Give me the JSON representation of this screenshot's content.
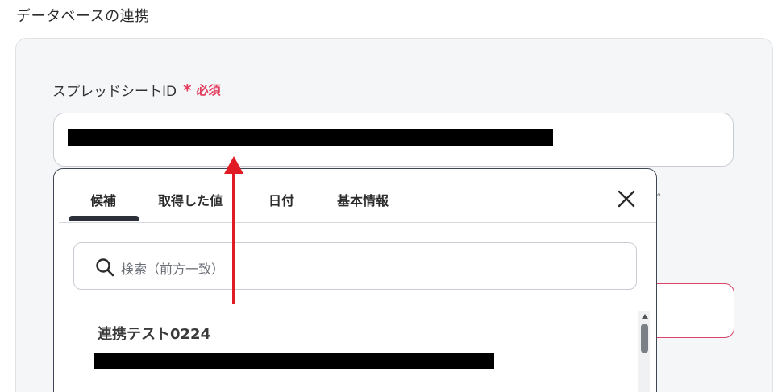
{
  "section": {
    "title": "データベースの連携"
  },
  "field": {
    "label": "スプレッドシートID",
    "required_mark": "*",
    "required_text": "必須",
    "redacted_value": ""
  },
  "hint": {
    "tail": "。"
  },
  "popup": {
    "tabs": [
      "候補",
      "取得した値",
      "日付",
      "基本情報"
    ],
    "active_tab": "候補",
    "search_placeholder": "検索（前方一致）",
    "results": [
      {
        "title": "連携テスト0224"
      }
    ]
  },
  "colors": {
    "accent_required": "#e23b5e",
    "annotation_arrow": "#e01b24",
    "tab_underline": "#2b2f38"
  },
  "icons": {
    "close": "close-icon",
    "search": "search-icon",
    "scroll_up": "chevron-up-icon"
  }
}
